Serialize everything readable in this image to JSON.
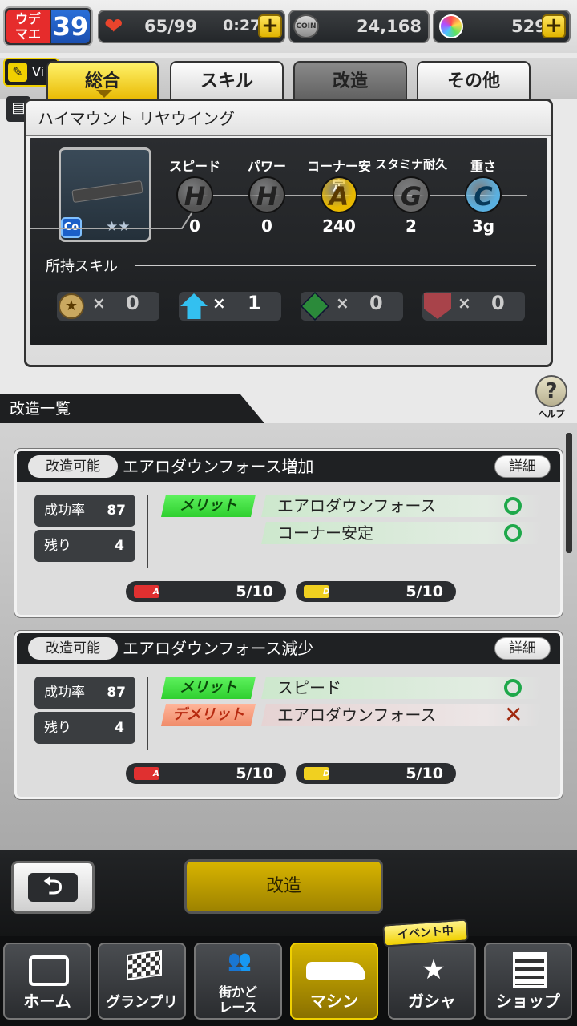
{
  "top": {
    "rank_label": "ウデマエ",
    "rank_value": "39",
    "stamina": "65/99",
    "timer": "0:27",
    "coin_label": "COIN",
    "coins": "24,168",
    "gems": "529",
    "plus_symbol": "+"
  },
  "tabs": [
    {
      "label": "総合",
      "active": true
    },
    {
      "label": "スキル",
      "active": false
    },
    {
      "label": "改造",
      "active": false
    },
    {
      "label": "その他",
      "active": false
    }
  ],
  "behind_text": "Vi",
  "part": {
    "name": "ハイマウント リヤウイング",
    "type_badge": "Co",
    "stars": "★★",
    "stats": [
      {
        "name": "スピード",
        "grade": "H",
        "value": "0",
        "color": "#555555"
      },
      {
        "name": "パワー",
        "grade": "H",
        "value": "0",
        "color": "#555555"
      },
      {
        "name": "コーナー安定",
        "grade": "A",
        "value": "240",
        "color": "#e8b800"
      },
      {
        "name": "スタミナ耐久",
        "grade": "G",
        "value": "2",
        "color": "#666666"
      },
      {
        "name": "重さ",
        "grade": "C",
        "value": "3g",
        "color": "#5ab0e0"
      }
    ],
    "skills_label": "所持スキル",
    "skills": [
      {
        "icon": "star-medal-icon",
        "count": "0"
      },
      {
        "icon": "blue-up-arrow-icon",
        "count": "1"
      },
      {
        "icon": "green-diamond-icon",
        "count": "0"
      },
      {
        "icon": "red-down-arrow-icon",
        "count": "0"
      }
    ],
    "multiply": "×"
  },
  "help_label": "ヘルプ",
  "list_title": "改造一覧",
  "mods": [
    {
      "badge": "改造可能",
      "title": "エアロダウンフォース増加",
      "detail": "詳細",
      "success_label": "成功率",
      "success": "87",
      "remain_label": "残り",
      "remain": "4",
      "effects": [
        {
          "tag": "メリット",
          "text": "エアロダウンフォース",
          "mark": "ok"
        },
        {
          "tag": "",
          "text": "コーナー安定",
          "mark": "ok"
        }
      ],
      "materials": [
        {
          "grade": "A",
          "count": "5/10",
          "color": "#e03030"
        },
        {
          "grade": "D",
          "count": "5/10",
          "color": "#f0d020"
        }
      ]
    },
    {
      "badge": "改造可能",
      "title": "エアロダウンフォース減少",
      "detail": "詳細",
      "success_label": "成功率",
      "success": "87",
      "remain_label": "残り",
      "remain": "4",
      "effects": [
        {
          "tag": "メリット",
          "text": "スピード",
          "mark": "ok"
        },
        {
          "tag": "デメリット",
          "text": "エアロダウンフォース",
          "mark": "x"
        }
      ],
      "materials": [
        {
          "grade": "A",
          "count": "5/10",
          "color": "#e03030"
        },
        {
          "grade": "D",
          "count": "5/10",
          "color": "#f0d020"
        }
      ]
    }
  ],
  "action": {
    "kaizo": "改造"
  },
  "event_badge": "イベント中",
  "nav": [
    {
      "label": "ホーム",
      "icon": "toolbox-icon"
    },
    {
      "label": "グランプリ",
      "icon": "checkered-flag-icon"
    },
    {
      "label": "街かど\nレース",
      "icon": "people-icon"
    },
    {
      "label": "マシン",
      "icon": "car-icon"
    },
    {
      "label": "ガシャ",
      "icon": "laurel-star-icon"
    },
    {
      "label": "ショップ",
      "icon": "building-icon"
    }
  ]
}
